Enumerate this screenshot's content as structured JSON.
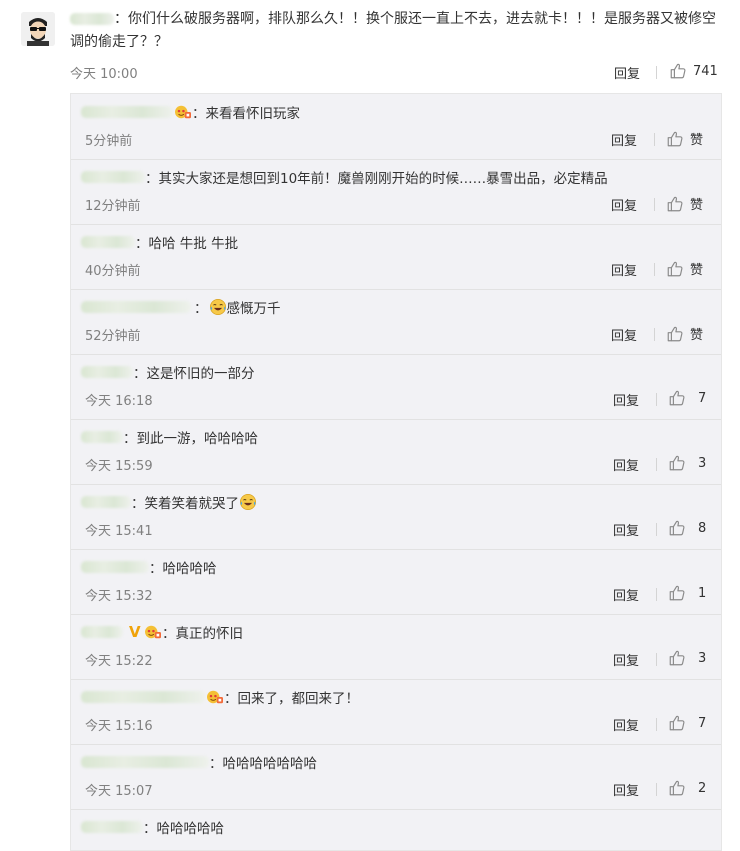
{
  "main_comment": {
    "text": "：你们什么破服务器啊，排队那么久！！换个服还一直上不去，进去就卡！！！是服务器又被修空调的偷走了？？",
    "time": "今天 10:00",
    "reply_label": "回复",
    "like_count": "741"
  },
  "replies": [
    {
      "text": "：来看看怀旧玩家",
      "time": "5分钟前",
      "reply_label": "回复",
      "like": "赞"
    },
    {
      "text": "：其实大家还是想回到10年前！魔兽刚刚开始的时候……暴雪出品，必定精品",
      "time": "12分钟前",
      "reply_label": "回复",
      "like": "赞"
    },
    {
      "text": "：哈哈  牛批 牛批",
      "time": "40分钟前",
      "reply_label": "回复",
      "like": "赞"
    },
    {
      "text": "感慨万千",
      "time": "52分钟前",
      "reply_label": "回复",
      "like": "赞"
    },
    {
      "text": "：这是怀旧的一部分",
      "time": "今天 16:18",
      "reply_label": "回复",
      "like": "7"
    },
    {
      "text": "：到此一游，哈哈哈哈",
      "time": "今天 15:59",
      "reply_label": "回复",
      "like": "3"
    },
    {
      "text": "：笑着笑着就哭了",
      "time": "今天 15:41",
      "reply_label": "回复",
      "like": "8"
    },
    {
      "text": "：哈哈哈哈",
      "time": "今天 15:32",
      "reply_label": "回复",
      "like": "1"
    },
    {
      "text": "：真正的怀旧",
      "time": "今天 15:22",
      "reply_label": "回复",
      "like": "3"
    },
    {
      "text": "：回来了，都回来了！",
      "time": "今天 15:16",
      "reply_label": "回复",
      "like": "7"
    },
    {
      "text": "：哈哈哈哈哈哈哈",
      "time": "今天 15:07",
      "reply_label": "回复",
      "like": "2"
    },
    {
      "text": "：哈哈哈哈哈",
      "time": "",
      "reply_label": "",
      "like": ""
    }
  ]
}
